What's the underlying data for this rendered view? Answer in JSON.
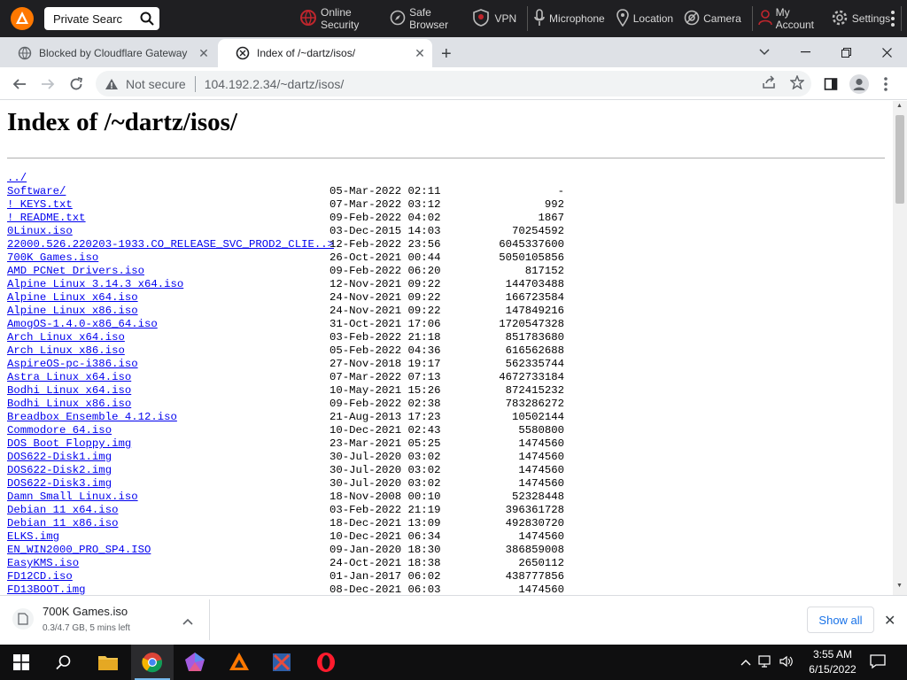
{
  "topbar": {
    "search_value": "Private Searc",
    "items": [
      {
        "label": "Online Security",
        "icon": "globe-shield-icon"
      },
      {
        "label": "Safe Browser",
        "icon": "compass-icon"
      },
      {
        "label": "VPN",
        "icon": "vpn-shield-icon"
      },
      {
        "label": "Microphone",
        "icon": "microphone-icon"
      },
      {
        "label": "Location",
        "icon": "location-pin-icon"
      },
      {
        "label": "Camera",
        "icon": "camera-icon"
      },
      {
        "label": "My Account",
        "icon": "user-icon"
      },
      {
        "label": "Settings",
        "icon": "gear-icon"
      }
    ]
  },
  "tabs": [
    {
      "title": "Blocked by Cloudflare Gateway",
      "active": false
    },
    {
      "title": "Index of /~dartz/isos/",
      "active": true
    }
  ],
  "toolbar": {
    "security_label": "Not secure",
    "url": "104.192.2.34/~dartz/isos/"
  },
  "page": {
    "heading": "Index of /~dartz/isos/",
    "parent_link": "../",
    "entries": [
      {
        "name": "Software/",
        "date": "05-Mar-2022 02:11",
        "size": "-"
      },
      {
        "name": "! KEYS.txt",
        "date": "07-Mar-2022 03:12",
        "size": "992"
      },
      {
        "name": "! README.txt",
        "date": "09-Feb-2022 04:02",
        "size": "1867"
      },
      {
        "name": "0Linux.iso",
        "date": "03-Dec-2015 14:03",
        "size": "70254592"
      },
      {
        "name": "22000.526.220203-1933.CO_RELEASE_SVC_PROD2_CLIE..>",
        "date": "12-Feb-2022 23:56",
        "size": "6045337600"
      },
      {
        "name": "700K Games.iso",
        "date": "26-Oct-2021 00:44",
        "size": "5050105856"
      },
      {
        "name": "AMD PCNet Drivers.iso",
        "date": "09-Feb-2022 06:20",
        "size": "817152"
      },
      {
        "name": "Alpine Linux 3.14.3 x64.iso",
        "date": "12-Nov-2021 09:22",
        "size": "144703488"
      },
      {
        "name": "Alpine Linux x64.iso",
        "date": "24-Nov-2021 09:22",
        "size": "166723584"
      },
      {
        "name": "Alpine Linux x86.iso",
        "date": "24-Nov-2021 09:22",
        "size": "147849216"
      },
      {
        "name": "AmogOS-1.4.0-x86_64.iso",
        "date": "31-Oct-2021 17:06",
        "size": "1720547328"
      },
      {
        "name": "Arch Linux x64.iso",
        "date": "03-Feb-2022 21:18",
        "size": "851783680"
      },
      {
        "name": "Arch Linux x86.iso",
        "date": "05-Feb-2022 04:36",
        "size": "616562688"
      },
      {
        "name": "AspireOS-pc-i386.iso",
        "date": "27-Nov-2018 19:17",
        "size": "562335744"
      },
      {
        "name": "Astra Linux x64.iso",
        "date": "07-Mar-2022 07:13",
        "size": "4672733184"
      },
      {
        "name": "Bodhi Linux x64.iso",
        "date": "10-May-2021 15:26",
        "size": "872415232"
      },
      {
        "name": "Bodhi Linux x86.iso",
        "date": "09-Feb-2022 02:38",
        "size": "783286272"
      },
      {
        "name": "Breadbox Ensemble 4.12.iso",
        "date": "21-Aug-2013 17:23",
        "size": "10502144"
      },
      {
        "name": "Commodore 64.iso",
        "date": "10-Dec-2021 02:43",
        "size": "5580800"
      },
      {
        "name": "DOS Boot Floppy.img",
        "date": "23-Mar-2021 05:25",
        "size": "1474560"
      },
      {
        "name": "DOS622-Disk1.img",
        "date": "30-Jul-2020 03:02",
        "size": "1474560"
      },
      {
        "name": "DOS622-Disk2.img",
        "date": "30-Jul-2020 03:02",
        "size": "1474560"
      },
      {
        "name": "DOS622-Disk3.img",
        "date": "30-Jul-2020 03:02",
        "size": "1474560"
      },
      {
        "name": "Damn Small Linux.iso",
        "date": "18-Nov-2008 00:10",
        "size": "52328448"
      },
      {
        "name": "Debian 11 x64.iso",
        "date": "03-Feb-2022 21:19",
        "size": "396361728"
      },
      {
        "name": "Debian 11 x86.iso",
        "date": "18-Dec-2021 13:09",
        "size": "492830720"
      },
      {
        "name": "ELKS.img",
        "date": "10-Dec-2021 06:34",
        "size": "1474560"
      },
      {
        "name": "EN_WIN2000_PRO_SP4.ISO",
        "date": "09-Jan-2020 18:30",
        "size": "386859008"
      },
      {
        "name": "EasyKMS.iso",
        "date": "24-Oct-2021 18:38",
        "size": "2650112"
      },
      {
        "name": "FD12CD.iso",
        "date": "01-Jan-2017 06:02",
        "size": "438777856"
      },
      {
        "name": "FD13BOOT.img",
        "date": "08-Dec-2021 06:03",
        "size": "1474560"
      }
    ]
  },
  "download": {
    "name": "700K Games.iso",
    "meta": "0.3/4.7 GB, 5 mins left",
    "show_all": "Show all"
  },
  "taskbar": {
    "time": "3:55 AM",
    "date": "6/15/2022"
  },
  "colors": {
    "link": "#0000ee",
    "topbar_bg": "#1f1f22",
    "tabstrip_bg": "#dee1e6",
    "avast_orange": "#ff7800",
    "security_red": "#c0262d"
  }
}
